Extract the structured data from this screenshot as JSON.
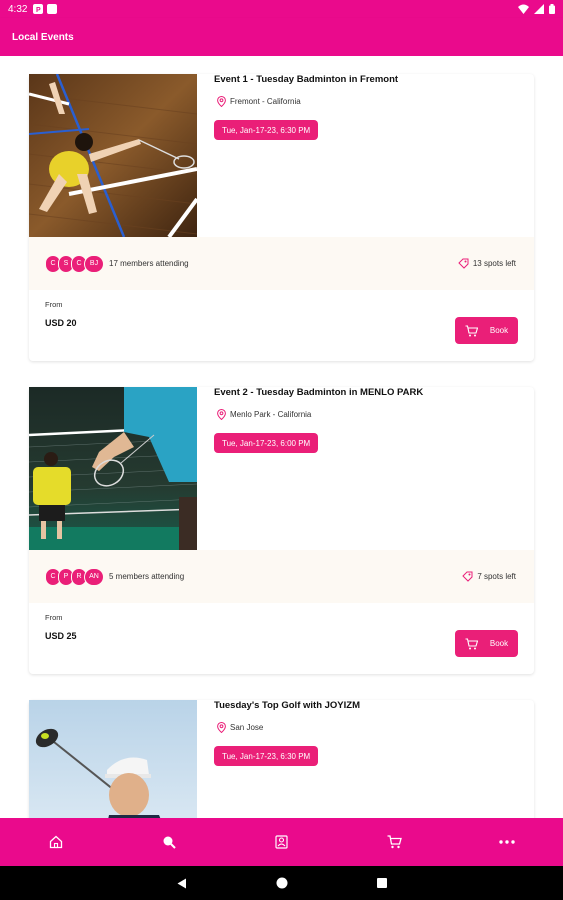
{
  "status_bar": {
    "time": "4:32",
    "icons": [
      "p-app-icon",
      "notification-icon",
      "wifi-icon",
      "signal-icon",
      "battery-icon"
    ]
  },
  "app_bar": {
    "title": "Local Events"
  },
  "colors": {
    "brand": "#ea0a8c",
    "chip": "#ea1f78",
    "strip": "#fdf9f3"
  },
  "events": [
    {
      "title": "Event 1 - Tuesday Badminton in Fremont",
      "location": "Fremont - California",
      "date": "Tue, Jan-17-23, 6:30 PM",
      "avatars": [
        "C",
        "S",
        "C",
        "BJ"
      ],
      "members": "17 members attending",
      "spots": "13 spots left",
      "from_label": "From",
      "price": "USD 20",
      "book_label": "Book"
    },
    {
      "title": "Event 2  - Tuesday Badminton in MENLO PARK",
      "location": "Menlo Park - California",
      "date": "Tue, Jan-17-23, 6:00 PM",
      "avatars": [
        "C",
        "P",
        "R",
        "AN"
      ],
      "members": "5 members attending",
      "spots": "7 spots left",
      "from_label": "From",
      "price": "USD 25",
      "book_label": "Book"
    },
    {
      "title": "Tuesday's Top Golf with JOYIZM",
      "location": "San Jose",
      "date": "Tue, Jan-17-23, 6:30 PM"
    }
  ],
  "bottom_nav": [
    "home-icon",
    "search-icon",
    "profile-icon",
    "cart-icon",
    "more-icon"
  ],
  "system_nav": [
    "back-icon",
    "home-circle-icon",
    "recents-icon"
  ]
}
